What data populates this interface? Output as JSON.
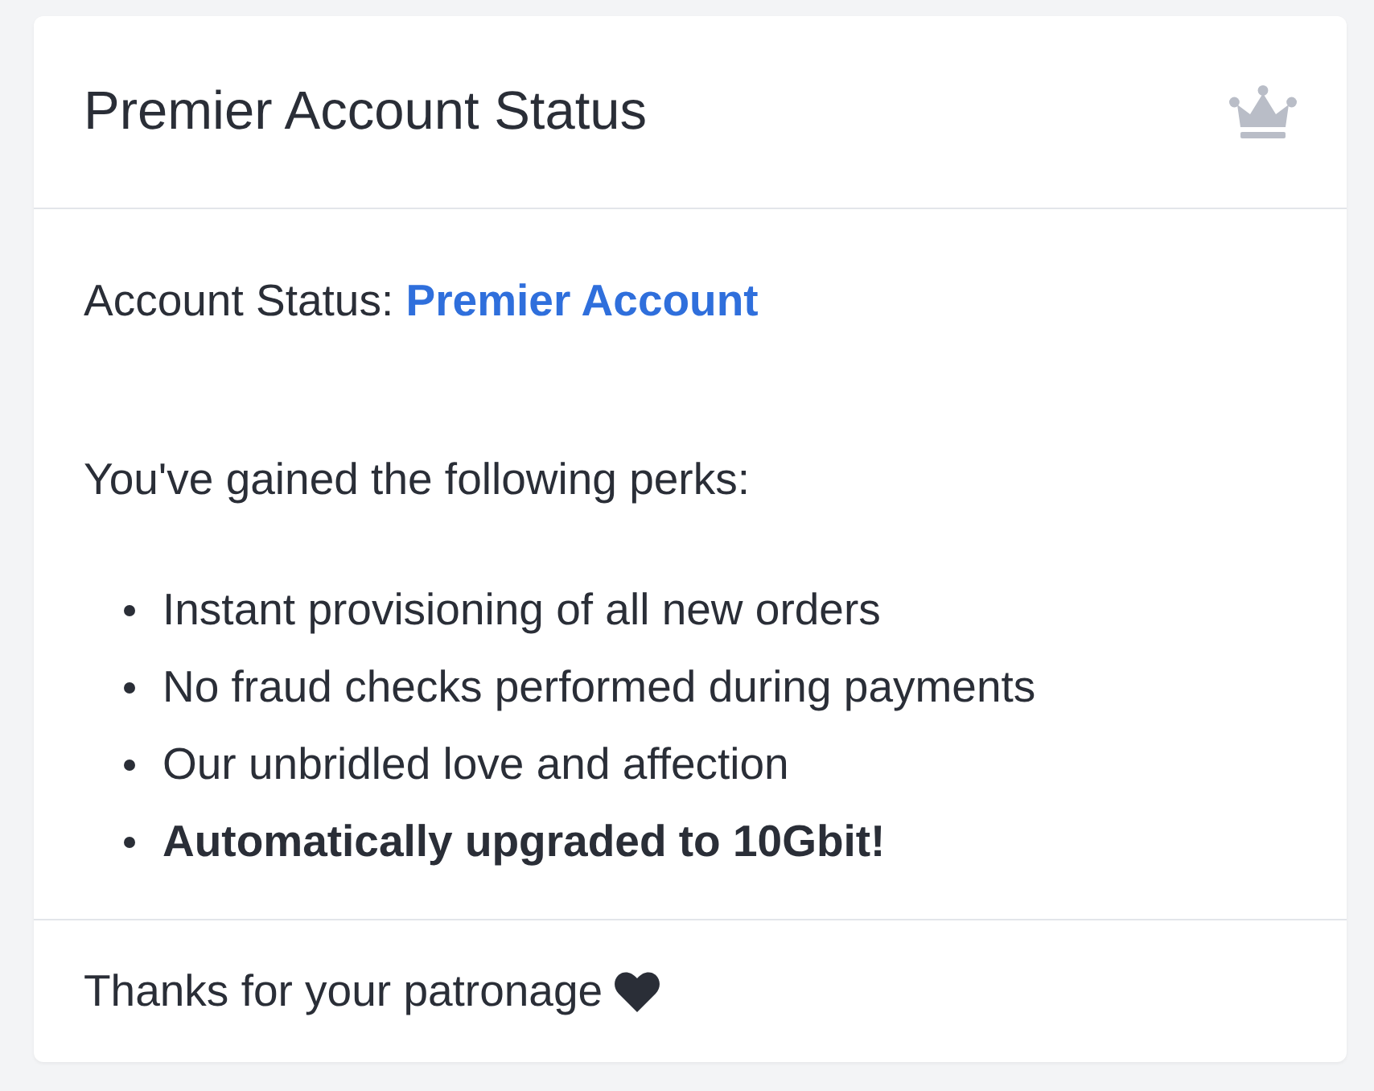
{
  "card": {
    "title": "Premier Account Status",
    "status": {
      "label": "Account Status:",
      "value": "Premier Account"
    },
    "intro": "You've gained the following perks:",
    "perks": [
      {
        "text": "Instant provisioning of all new orders",
        "bold": false
      },
      {
        "text": "No fraud checks performed during payments",
        "bold": false
      },
      {
        "text": "Our unbridled love and affection",
        "bold": false
      },
      {
        "text": "Automatically upgraded to 10Gbit!",
        "bold": true
      }
    ],
    "footer": {
      "text": "Thanks for your patronage"
    }
  }
}
